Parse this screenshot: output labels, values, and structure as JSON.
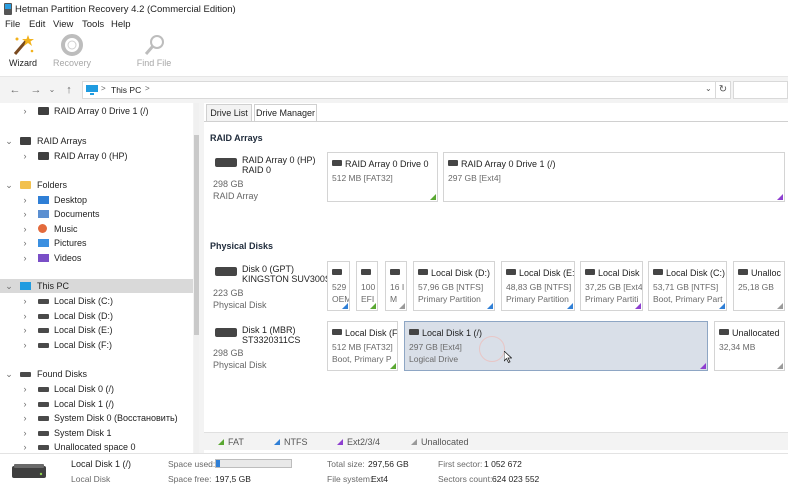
{
  "window": {
    "title": "Hetman Partition Recovery 4.2 (Commercial Edition)"
  },
  "menu": [
    "File",
    "Edit",
    "View",
    "Tools",
    "Help"
  ],
  "toolbar": {
    "wizard": "Wizard",
    "recovery": "Recovery",
    "find_file": "Find File"
  },
  "address": {
    "path": "This PC",
    "separator": ">"
  },
  "tree": {
    "raid_drive1": "RAID Array 0 Drive 1 (/)",
    "raid_arrays": "RAID Arrays",
    "raid_hp": "RAID Array 0 (HP)",
    "folders": "Folders",
    "desktop": "Desktop",
    "documents": "Documents",
    "music": "Music",
    "pictures": "Pictures",
    "videos": "Videos",
    "this_pc": "This PC",
    "local_c": "Local Disk (C:)",
    "local_d": "Local Disk (D:)",
    "local_e": "Local Disk (E:)",
    "local_f": "Local Disk (F:)",
    "found_disks": "Found Disks",
    "found_ld0": "Local Disk 0 (/)",
    "found_ld1": "Local Disk 1 (/)",
    "found_sys0": "System Disk 0 (Восстановить)",
    "found_sys1": "System Disk 1",
    "found_unalloc": "Unallocated space 0"
  },
  "tabs": {
    "drive_list": "Drive List",
    "drive_manager": "Drive Manager"
  },
  "raid": {
    "section": "RAID Arrays",
    "name": "RAID Array 0 (HP)",
    "sub": "RAID 0",
    "size": "298 GB",
    "type": "RAID Array",
    "p1": {
      "title": "RAID Array 0 Drive 0",
      "info": "512 MB [FAT32]"
    },
    "p2": {
      "title": "RAID Array 0 Drive 1 (/)",
      "info": "297 GB [Ext4]"
    }
  },
  "physical": {
    "section": "Physical Disks",
    "disk0": {
      "name": "Disk 0 (GPT)",
      "model": "KINGSTON SUV300S",
      "size": "223 GB",
      "type": "Physical Disk",
      "parts": [
        {
          "title": "OEM",
          "a": "529",
          "b": "OEM"
        },
        {
          "title": "",
          "a": "100",
          "b": "EFI"
        },
        {
          "title": "",
          "a": "16 I",
          "b": "M"
        },
        {
          "title": "Local Disk (D:)",
          "a": "57,96 GB [NTFS]",
          "b": "Primary Partition"
        },
        {
          "title": "Local Disk (E:",
          "a": "48,83 GB [NTFS]",
          "b": "Primary Partition"
        },
        {
          "title": "Local Disk",
          "a": "37,25 GB [Ext4]",
          "b": "Primary Partiti"
        },
        {
          "title": "Local Disk (C:)",
          "a": "53,71 GB [NTFS]",
          "b": "Boot, Primary Part"
        },
        {
          "title": "Unalloc",
          "a": "25,18 GB",
          "b": ""
        }
      ]
    },
    "disk1": {
      "name": "Disk 1 (MBR)",
      "model": "ST3320311CS",
      "size": "298 GB",
      "type": "Physical Disk",
      "parts": [
        {
          "title": "Local Disk (F",
          "a": "512 MB [FAT32]",
          "b": "Boot, Primary P"
        },
        {
          "title": "Local Disk 1 (/)",
          "a": "297 GB [Ext4]",
          "b": "Logical Drive"
        },
        {
          "title": "Unallocated",
          "a": "32,34 MB",
          "b": ""
        }
      ]
    }
  },
  "legend": {
    "fat": "FAT",
    "ntfs": "NTFS",
    "ext": "Ext2/3/4",
    "unalloc": "Unallocated"
  },
  "colors": {
    "fat": "#5aa832",
    "ntfs": "#2f7fd6",
    "ext": "#8e3fd0",
    "unalloc": "#9a9a9a",
    "selection": "#d9dfe8",
    "used_bar": "#2f7fd6"
  },
  "status": {
    "name": "Local Disk 1 (/)",
    "kind": "Local Disk",
    "space_used_label": "Space used:",
    "space_used_fraction": 0.05,
    "space_free_label": "Space free:",
    "space_free": "197,5 GB",
    "total_size_label": "Total size:",
    "total_size": "297,56 GB",
    "file_system_label": "File system:",
    "file_system": "Ext4",
    "first_sector_label": "First sector:",
    "first_sector": "1 052 672",
    "sectors_count_label": "Sectors count:",
    "sectors_count": "624 023 552"
  }
}
